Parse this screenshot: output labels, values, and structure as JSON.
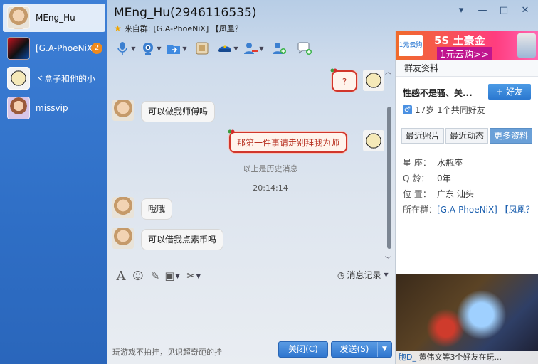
{
  "contacts": [
    {
      "name": "MEng_Hu",
      "badge": ""
    },
    {
      "name": "[G.A-PhoeNiX",
      "badge": "2"
    },
    {
      "name": "ヾ盒子和他的小",
      "badge": ""
    },
    {
      "name": "missvip",
      "badge": ""
    }
  ],
  "header": {
    "title": "MEng_Hu(2946116535)",
    "from_label": "来自群:",
    "from_group": "[G.A-PhoeNiX] 【凤凰？"
  },
  "toolbar": {
    "icons": [
      "microphone-icon",
      "video-camera-icon",
      "file-transfer-icon",
      "app-box-icon",
      "police-hat-icon",
      "remove-user-icon",
      "add-user-icon",
      "chat-add-icon"
    ]
  },
  "messages": [
    {
      "side": "right",
      "text": "?",
      "style": "red"
    },
    {
      "side": "left",
      "text": "可以做我师傅吗",
      "style": "normal"
    },
    {
      "side": "right",
      "text": "那第一件事请走别拜我为师",
      "style": "red"
    },
    {
      "side": "left",
      "text": "哦哦",
      "style": "normal"
    },
    {
      "side": "left",
      "text": "可以借我点素币吗",
      "style": "normal"
    }
  ],
  "system": {
    "history_divider": "以上是历史消息",
    "timestamp": "20:14:14"
  },
  "input": {
    "history_label": "消息记录",
    "hint": "玩游戏不拍挂，见识超奇葩的挂",
    "close_label": "关闭(C)",
    "send_label": "发送(S)"
  },
  "ad": {
    "logo": "1元云购",
    "line1": "5S 土豪金",
    "line2": "1元云购>>"
  },
  "profile": {
    "header": "群友资料",
    "nickname": "性感不是骚、关...",
    "add_friend": "+ 好友",
    "age_line": "17岁  1个共同好友",
    "tabs": [
      "最近照片",
      "最近动态",
      "更多资料"
    ],
    "fields": [
      {
        "label": "星    座：",
        "value": "水瓶座"
      },
      {
        "label": "Q    龄：",
        "value": "0年"
      },
      {
        "label": "位    置：",
        "value": "广东 汕头"
      },
      {
        "label": "所在群：",
        "value": "[G.A-PhoeNiX] 【凤凰？"
      }
    ]
  },
  "game": {
    "caption_name": "胞D_",
    "caption_rest": "黄伟文等3个好友在玩..."
  },
  "colors": {
    "sidebar": "#3d7fd6",
    "accent_button": "#2f76cf",
    "red_bubble_border": "#d1362b",
    "badge": "#f08a1c"
  }
}
